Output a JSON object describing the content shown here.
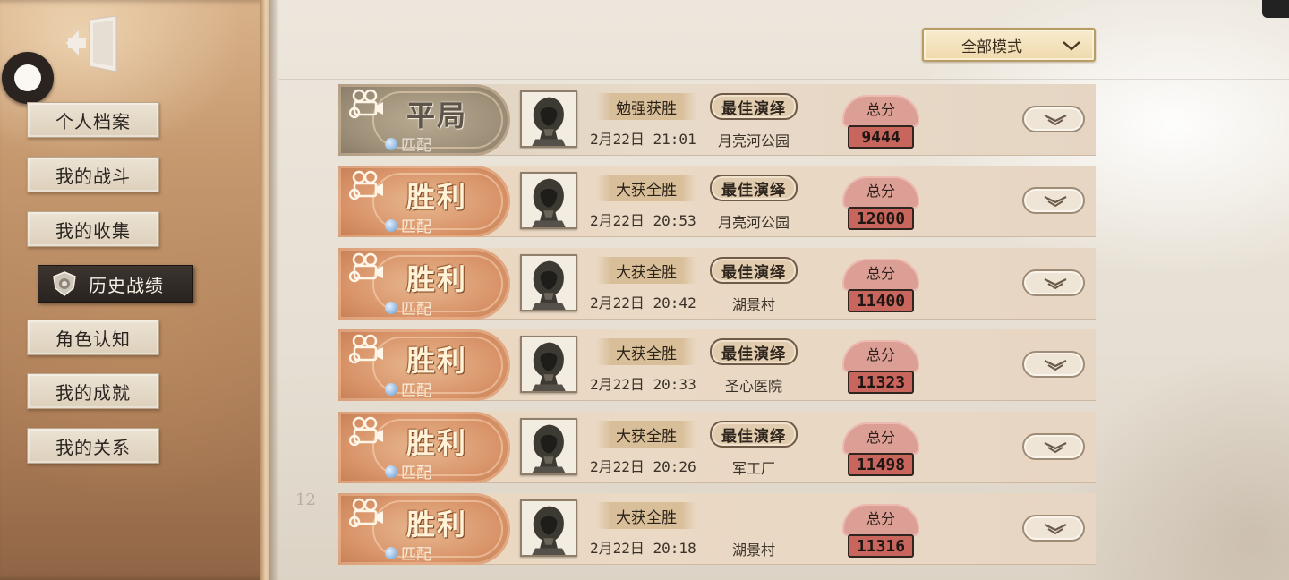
{
  "sidebar": {
    "items": [
      {
        "label": "个人档案",
        "active": false
      },
      {
        "label": "我的战斗",
        "active": false
      },
      {
        "label": "我的收集",
        "active": false
      },
      {
        "label": "历史战绩",
        "active": true
      },
      {
        "label": "角色认知",
        "active": false
      },
      {
        "label": "我的成就",
        "active": false
      },
      {
        "label": "我的关系",
        "active": false
      }
    ],
    "exit_icon": "exit-door-icon",
    "active_icon": "shield-emblem-icon"
  },
  "filter": {
    "selected": "全部模式",
    "icon": "chevron-down-icon"
  },
  "page_mark": "12",
  "matches": [
    {
      "result": "平局",
      "mode": "匹配",
      "outcome": "勉强获胜",
      "datetime": "2月22日 21:01",
      "best": "最佳演绎",
      "map": "月亮河公园",
      "score_label": "总分",
      "score": "9444",
      "kind": "draw"
    },
    {
      "result": "胜利",
      "mode": "匹配",
      "outcome": "大获全胜",
      "datetime": "2月22日 20:53",
      "best": "最佳演绎",
      "map": "月亮河公园",
      "score_label": "总分",
      "score": "12000",
      "kind": "win"
    },
    {
      "result": "胜利",
      "mode": "匹配",
      "outcome": "大获全胜",
      "datetime": "2月22日 20:42",
      "best": "最佳演绎",
      "map": "湖景村",
      "score_label": "总分",
      "score": "11400",
      "kind": "win"
    },
    {
      "result": "胜利",
      "mode": "匹配",
      "outcome": "大获全胜",
      "datetime": "2月22日 20:33",
      "best": "最佳演绎",
      "map": "圣心医院",
      "score_label": "总分",
      "score": "11323",
      "kind": "win"
    },
    {
      "result": "胜利",
      "mode": "匹配",
      "outcome": "大获全胜",
      "datetime": "2月22日 20:26",
      "best": "最佳演绎",
      "map": "军工厂",
      "score_label": "总分",
      "score": "11498",
      "kind": "win"
    },
    {
      "result": "胜利",
      "mode": "匹配",
      "outcome": "大获全胜",
      "datetime": "2月22日 20:18",
      "best": "",
      "map": "湖景村",
      "score_label": "总分",
      "score": "11316",
      "kind": "win"
    }
  ],
  "colors": {
    "win_plate": "#d9946a",
    "draw_plate": "#9e9079",
    "score_value_bg": "#c8665d",
    "score_label_bg": "#dc9f95"
  }
}
